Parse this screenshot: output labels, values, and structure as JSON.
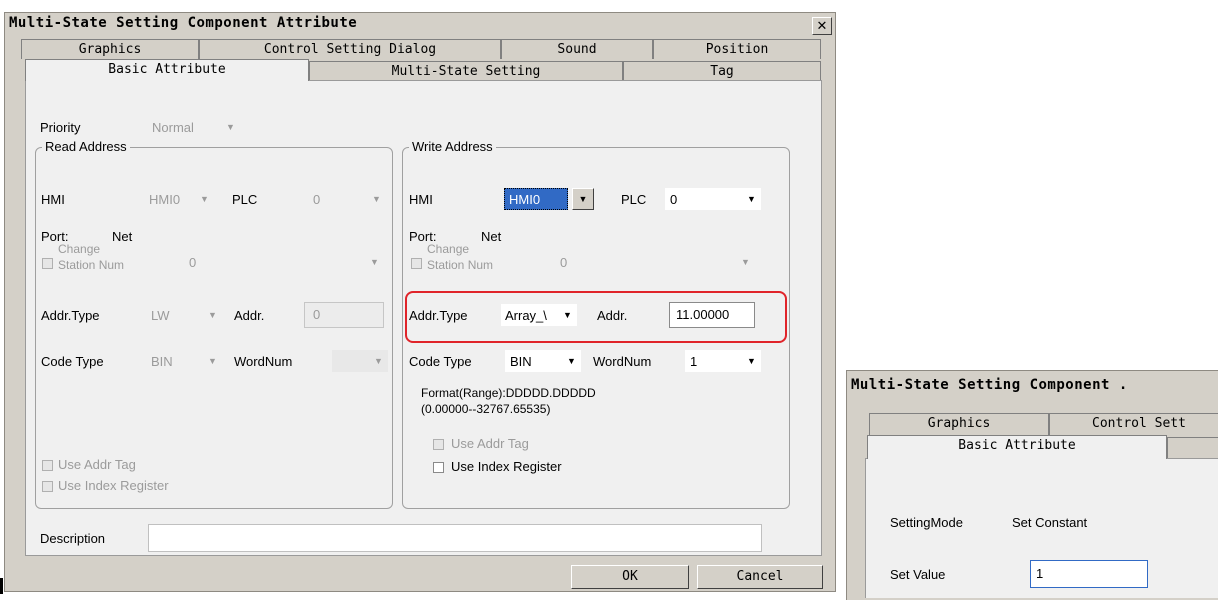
{
  "main_dialog": {
    "title": "Multi-State Setting Component Attribute",
    "close_glyph": "✕",
    "tabs_back": [
      "Graphics",
      "Control Setting Dialog",
      "Sound",
      "Position"
    ],
    "tabs_front": [
      "Basic Attribute",
      "Multi-State Setting",
      "Tag"
    ],
    "priority": {
      "label": "Priority",
      "value": "Normal"
    },
    "read_address": {
      "legend": "Read Address",
      "hmi_label": "HMI",
      "hmi_value": "HMI0",
      "plc_label": "PLC",
      "plc_value": "0",
      "port_label": "Port:",
      "port_value": "Net",
      "change_station_line1": "Change",
      "change_station_line2": "Station Num",
      "station_value": "0",
      "addr_type_label": "Addr.Type",
      "addr_type_value": "LW",
      "addr_label": "Addr.",
      "addr_value": "0",
      "code_type_label": "Code Type",
      "code_type_value": "BIN",
      "wordnum_label": "WordNum",
      "wordnum_value": "",
      "use_addr_tag": "Use Addr Tag",
      "use_index_register": "Use Index Register"
    },
    "write_address": {
      "legend": "Write Address",
      "hmi_label": "HMI",
      "hmi_value": "HMI0",
      "plc_label": "PLC",
      "plc_value": "0",
      "port_label": "Port:",
      "port_value": "Net",
      "change_station_line1": "Change",
      "change_station_line2": "Station Num",
      "station_value": "0",
      "addr_type_label": "Addr.Type",
      "addr_type_value": "Array_\\",
      "addr_label": "Addr.",
      "addr_value": "11.00000",
      "code_type_label": "Code Type",
      "code_type_value": "BIN",
      "wordnum_label": "WordNum",
      "wordnum_value": "1",
      "format_line1": "Format(Range):DDDDD.DDDDD",
      "format_line2": "(0.00000--32767.65535)",
      "use_addr_tag": "Use Addr Tag",
      "use_index_register": "Use Index Register"
    },
    "description_label": "Description",
    "description_value": "",
    "ok_label": "OK",
    "cancel_label": "Cancel",
    "highlight_color": "#e0242a"
  },
  "second_dialog": {
    "title": "Multi-State Setting Component .",
    "tabs_back": [
      "Graphics",
      "Control Sett"
    ],
    "tabs_front": [
      "Basic Attribute"
    ],
    "setting_mode_label": "SettingMode",
    "setting_mode_value": "Set Constant",
    "set_value_label": "Set Value",
    "set_value_value": "1"
  }
}
